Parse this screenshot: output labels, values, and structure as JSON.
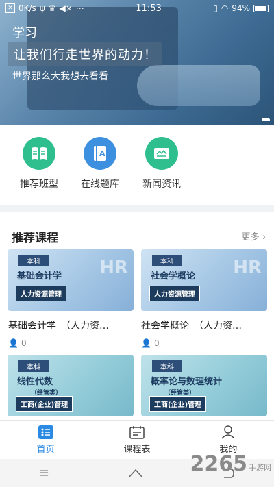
{
  "status_bar": {
    "speed": "0K/s",
    "time": "11:53",
    "battery": "94%"
  },
  "banner": {
    "title": "学习",
    "slogan": "让我们行走世界的动力！",
    "subtitle": "世界那么大我想去看看"
  },
  "quick_links": [
    {
      "label": "推荐班型",
      "icon": "book-icon",
      "color": "#2fbf8f"
    },
    {
      "label": "在线题库",
      "icon": "question-bank-icon",
      "color": "#3d8fe0"
    },
    {
      "label": "新闻资讯",
      "icon": "news-icon",
      "color": "#2fbf8f"
    }
  ],
  "section": {
    "title": "推荐课程",
    "more": "更多"
  },
  "courses": [
    {
      "badge": "本科",
      "title": "基础会计学",
      "sub": "",
      "tag": "人力资源管理",
      "deco": "HR",
      "name": "基础会计学　（人力资…",
      "count": "0"
    },
    {
      "badge": "本科",
      "title": "社会学概论",
      "sub": "",
      "tag": "人力资源管理",
      "deco": "HR",
      "name": "社会学概论　（人力资…",
      "count": "0"
    },
    {
      "badge": "本科",
      "title": "线性代数",
      "sub": "（经管类）",
      "tag": "工商(企业)管理",
      "deco": "",
      "name": "",
      "count": ""
    },
    {
      "badge": "本科",
      "title": "概率论与数理统计",
      "sub": "（经管类）",
      "tag": "工商(企业)管理",
      "deco": "",
      "name": "",
      "count": ""
    }
  ],
  "tabs": [
    {
      "label": "首页",
      "icon": "home-grid-icon"
    },
    {
      "label": "课程表",
      "icon": "calendar-icon"
    },
    {
      "label": "我的",
      "icon": "user-icon"
    }
  ],
  "watermark": {
    "number": "2265",
    "text": "手游网"
  },
  "colors": {
    "accent": "#2b8ae3",
    "green": "#2fbf8f",
    "card_tag": "#1d3b5c"
  }
}
